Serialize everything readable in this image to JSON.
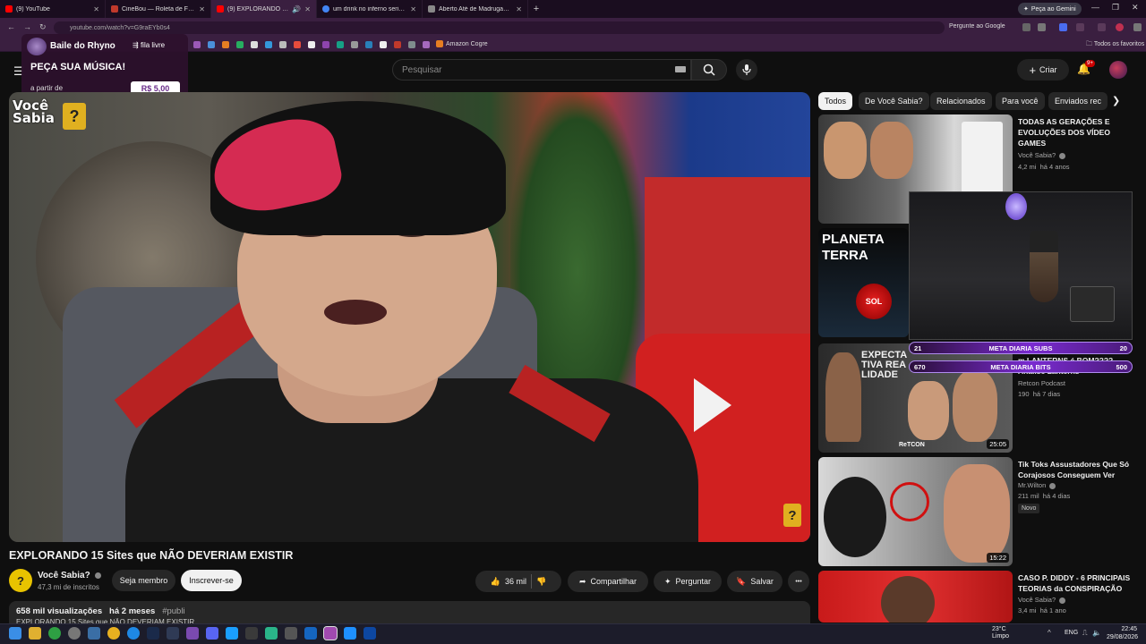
{
  "browser": {
    "tabs": [
      {
        "title": "(9) YouTube",
        "color": "#ff0000"
      },
      {
        "title": "CineBou — Roleta de Filmes",
        "color": "#c0392b"
      },
      {
        "title": "(9) EXPLORANDO 15 Sites q",
        "color": "#ff0000",
        "active": true
      },
      {
        "title": "um drink no inferno serie cast",
        "color": "#4285f4"
      },
      {
        "title": "Aberto Até de Madrugada filme",
        "color": "#888888"
      }
    ],
    "new_tab": "+",
    "gemini_button": "Peça ao Gemini",
    "url": "youtube.com/watch?v=G9raEYb0s4",
    "ask_google": "Pergunte ao Google",
    "bookmark_amazon": "Amazon Cogre",
    "bookmark_all": "Todos os favoritos"
  },
  "overlay": {
    "title": "Baile do Rhyno",
    "queue": "fila livre",
    "headline": "PEÇA SUA MÚSICA!",
    "from_label": "a partir de",
    "price": "R$ 5,00"
  },
  "youtube": {
    "search_placeholder": "Pesquisar",
    "create_label": "Criar",
    "notif_count": "9+",
    "watermark_text": "Você Sabia",
    "watermark_q": "?",
    "corner_q": "?"
  },
  "video": {
    "title": "EXPLORANDO 15 Sites que NÃO DEVERIAM EXISTIR",
    "channel": "Você Sabia?",
    "channel_initial": "?",
    "subscribers": "47,3 mi de inscritos",
    "join_label": "Seja membro",
    "subscribe_label": "Inscrever-se",
    "likes": "36 mil",
    "share_label": "Compartilhar",
    "ask_label": "Perguntar",
    "save_label": "Salvar",
    "more_label": "•••",
    "views": "658 mil visualizações",
    "age": "há 2 meses",
    "hashtag": "#publi",
    "desc_line": "EXPLORANDO 15 Sites que NÃO DEVERIAM EXISTIR"
  },
  "sidebar": {
    "chips": [
      "Todos",
      "De Você Sabia?",
      "Relacionados",
      "Para você",
      "Enviados rec"
    ],
    "items": [
      {
        "title": "TODAS AS GERAÇÕES E EVOLUÇÕES DOS VÍDEO GAMES",
        "channel": "Você Sabia?",
        "views": "4,2 mi",
        "age": "há 4 anos",
        "duration": ""
      },
      {
        "title": "PLANETA TERRA",
        "thumb_word": "SOL",
        "channel": "",
        "views": "",
        "age": "",
        "duration": ""
      },
      {
        "title": "m LANTERNS é BOM???? - Análise Lanterns",
        "channel": "Retcon Podcast",
        "views": "190",
        "age": "há 7 dias",
        "duration": "25:05",
        "thumb_text": "EXPECTATIVA REALIDADE",
        "thumb_brand": "ReTCON"
      },
      {
        "title": "Tik Toks Assustadores Que Só Corajosos Conseguem Ver",
        "channel": "Mr.Wilton",
        "views": "211 mil",
        "age": "há 4 dias",
        "duration": "15:22",
        "badge": "Novo"
      },
      {
        "title": "CASO P. DIDDY - 6 PRINCIPAIS TEORIAS da CONSPIRAÇÃO",
        "channel": "Você Sabia?",
        "views": "3,4 mi",
        "age": "há 1 ano",
        "duration": ""
      }
    ],
    "meta_subs": {
      "left": "21",
      "label": "META DIARIA SUBS",
      "right": "20"
    },
    "meta_bits": {
      "left": "670",
      "label": "META DIARIA BITS",
      "right": "500"
    }
  },
  "taskbar": {
    "weather_temp": "23°C",
    "weather_desc": "Limpo",
    "lang": "ENG",
    "time": "22:45",
    "date": "29/08/2026"
  }
}
